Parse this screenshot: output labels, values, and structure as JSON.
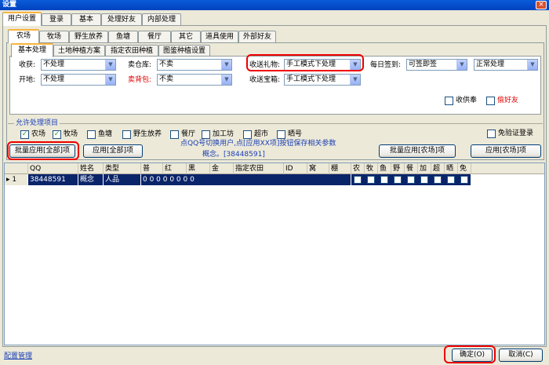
{
  "window": {
    "title": "设置",
    "close_icon": "×"
  },
  "top_tabs": [
    "用户设置",
    "登录",
    "基本",
    "处理好友",
    "内部处理"
  ],
  "farm_tabs": [
    "农场",
    "牧场",
    "野生放养",
    "鱼塘",
    "餐厅",
    "其它",
    "道具使用",
    "外部好友"
  ],
  "sub_tabs": [
    "基本处理",
    "土地种植方案",
    "指定农田种植",
    "图鉴种植设置"
  ],
  "settings": {
    "harvest_label": "收获:",
    "harvest_value": "不处理",
    "sell_label": "卖仓库:",
    "sell_value": "不卖",
    "gift_label": "收送礼物:",
    "gift_value": "手工模式下处理",
    "sign_label": "每日签到:",
    "sign_value": "可签即签",
    "normal_value": "正常处理",
    "open_label": "开地:",
    "open_value": "不处理",
    "bag_label": "卖背包:",
    "bag_value": "不卖",
    "box_label": "收送宝箱:",
    "box_value": "手工模式下处理",
    "collect_label": "收供奉",
    "steal_label": "偷好友"
  },
  "allow": {
    "title": "允许处理项目",
    "items": [
      "农场",
      "牧场",
      "鱼塘",
      "野生放养",
      "餐厅",
      "加工坊",
      "超市",
      "晒号"
    ],
    "checked": [
      true,
      true,
      false,
      false,
      false,
      false,
      false,
      false
    ],
    "verify_label": "免验证登录"
  },
  "buttons": {
    "batch_all": "批量应用[全部]项",
    "apply_all": "应用[全部]项",
    "batch_farm": "批量应用[农场]项",
    "apply_farm": "应用[农场]项",
    "ok": "确定(O)",
    "cancel": "取消(C)"
  },
  "hint": {
    "line1": "点QQ号切换用户,点[应用XX项]按钮保存相关参数",
    "line2": "概念。[38448591]"
  },
  "grid": {
    "headers": [
      "QQ",
      "姓名",
      "类型",
      "普",
      "红",
      "黑",
      "金",
      "指定农田",
      "ID",
      "窝",
      "棚",
      "农",
      "牧",
      "鱼",
      "野",
      "餐",
      "加",
      "超",
      "晒",
      "免"
    ],
    "row": {
      "index": "1",
      "qq": "38448591",
      "name": "概念",
      "type": "人品",
      "values": "0 0 0 0 0 0 0 0"
    }
  },
  "footer": {
    "config": "配置管理"
  }
}
